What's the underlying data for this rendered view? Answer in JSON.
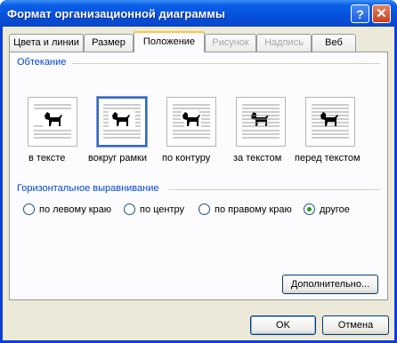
{
  "window": {
    "title": "Формат организационной диаграммы",
    "help_label": "?",
    "close_label": "✕"
  },
  "tabs": [
    {
      "label": "Цвета и линии",
      "state": "normal"
    },
    {
      "label": "Размер",
      "state": "normal"
    },
    {
      "label": "Положение",
      "state": "active"
    },
    {
      "label": "Рисунок",
      "state": "disabled"
    },
    {
      "label": "Надпись",
      "state": "disabled"
    },
    {
      "label": "Веб",
      "state": "normal"
    }
  ],
  "wrapping": {
    "group_label": "Обтекание",
    "options": [
      {
        "label": "в тексте",
        "icon": "inline-dog-icon",
        "selected": false
      },
      {
        "label": "вокруг рамки",
        "icon": "square-dog-icon",
        "selected": true
      },
      {
        "label": "по контуру",
        "icon": "tight-dog-icon",
        "selected": false
      },
      {
        "label": "за текстом",
        "icon": "behind-text-dog-icon",
        "selected": false
      },
      {
        "label": "перед текстом",
        "icon": "in-front-dog-icon",
        "selected": false
      }
    ]
  },
  "horizontal_alignment": {
    "group_label": "Горизонтальное выравнивание",
    "options": [
      {
        "label": "по левому краю",
        "checked": false
      },
      {
        "label": "по центру",
        "checked": false
      },
      {
        "label": "по правому краю",
        "checked": false
      },
      {
        "label": "другое",
        "checked": true
      }
    ]
  },
  "buttons": {
    "advanced": "Дополнительно...",
    "ok": "OK",
    "cancel": "Отмена"
  },
  "colors": {
    "title_bar": "#0550dc",
    "dialog_bg": "#ece9d8",
    "group_label": "#0046d5",
    "selected_border": "#316ac5"
  }
}
